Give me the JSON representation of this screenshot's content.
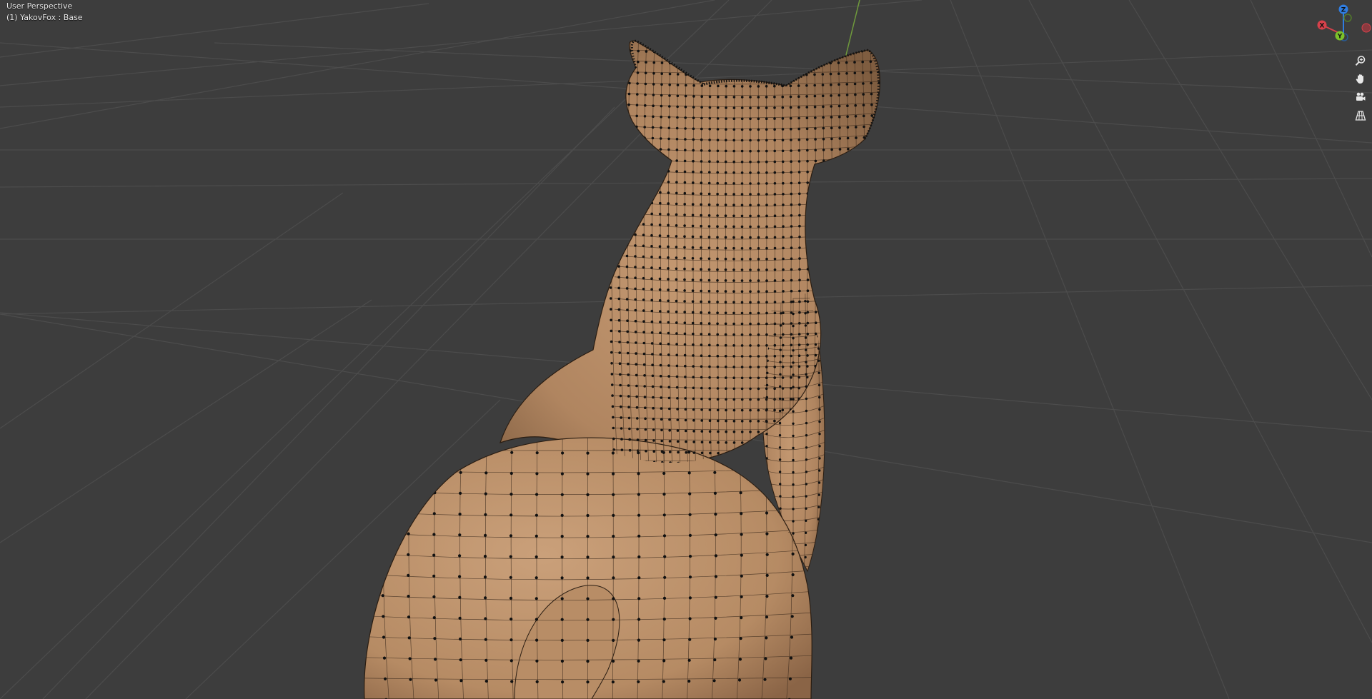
{
  "viewport": {
    "mode_label": "User Perspective",
    "object_label": "(1) YakovFox : Base",
    "background": "#3d3d3d",
    "grid_color": "#4c4c4c",
    "y_axis_line_color": "#6f9a3c",
    "mesh_color": "#b58a63",
    "vertex_color": "#111111"
  },
  "gizmo": {
    "axes": [
      {
        "label": "Z",
        "color": "#2f7de1"
      },
      {
        "label": "X",
        "color": "#d7414b"
      },
      {
        "label": "Y",
        "color": "#7cc12a"
      },
      {
        "label": "",
        "color": "#8a3a3f"
      },
      {
        "label": "",
        "color": "#527a2b"
      },
      {
        "label": "",
        "color": "#2a5a92"
      }
    ]
  },
  "nav_buttons": [
    {
      "icon": "zoom-icon"
    },
    {
      "icon": "hand-pan-icon"
    },
    {
      "icon": "camera-icon"
    },
    {
      "icon": "ortho-grid-icon"
    }
  ]
}
